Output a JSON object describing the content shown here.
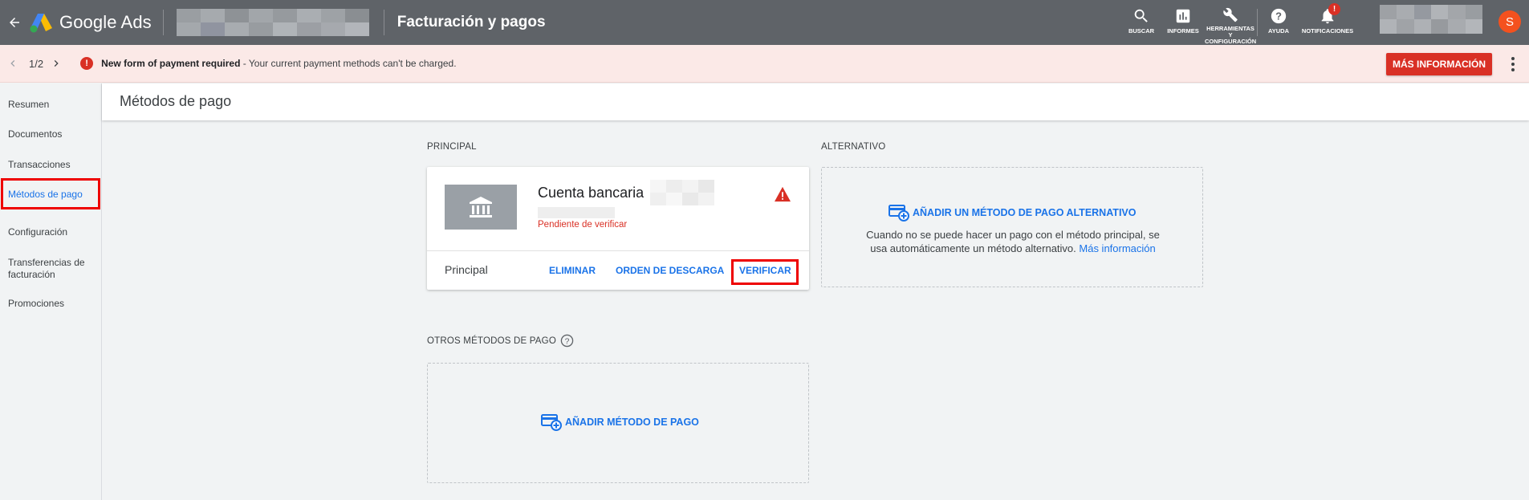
{
  "topbar": {
    "app_name": "Google Ads",
    "page_title": "Facturación y pagos",
    "tools": [
      {
        "label": "BUSCAR",
        "icon": "search-icon"
      },
      {
        "label": "INFORMES",
        "icon": "bar-chart-icon"
      },
      {
        "label": "HERRAMIENTAS Y CONFIGURACIÓN",
        "icon": "wrench-icon"
      },
      {
        "label": "AYUDA",
        "icon": "help-icon"
      },
      {
        "label": "NOTIFICACIONES",
        "icon": "bell-icon"
      }
    ],
    "notification_badge": "!",
    "avatar_initial": "S",
    "colors": {
      "bar": "#5f6368",
      "avatar": "#f4511e"
    }
  },
  "alert": {
    "pager": "1/2",
    "icon_glyph": "!",
    "title": "New form of payment required",
    "message": " - Your current payment methods can't be charged.",
    "button_label": "MÁS INFORMACIÓN",
    "colors": {
      "background": "#fbe9e7",
      "button": "#d93025"
    }
  },
  "sidebar": {
    "items": [
      {
        "label": "Resumen"
      },
      {
        "label": "Documentos"
      },
      {
        "label": "Transacciones"
      },
      {
        "label": "Métodos de pago",
        "active": true
      },
      {
        "label": "Configuración"
      },
      {
        "label": "Transferencias de facturación"
      },
      {
        "label": "Promociones"
      }
    ]
  },
  "main": {
    "title": "Métodos de pago",
    "principal": {
      "section_label": "PRINCIPAL",
      "card": {
        "title": "Cuenta bancaria",
        "status": "Pendiente de verificar",
        "footer_label": "Principal",
        "actions": [
          "ELIMINAR",
          "ORDEN DE DESCARGA",
          "VERIFICAR"
        ]
      }
    },
    "alternativo": {
      "section_label": "ALTERNATIVO",
      "add_label": "AÑADIR UN MÉTODO DE PAGO ALTERNATIVO",
      "description": "Cuando no se puede hacer un pago con el método principal, se usa automáticamente un método alternativo.",
      "link": "Más información"
    },
    "otros": {
      "section_label": "OTROS MÉTODOS DE PAGO",
      "add_label": "AÑADIR MÉTODO DE PAGO"
    },
    "accent_color": "#1a73e8",
    "error_color": "#d93025"
  }
}
